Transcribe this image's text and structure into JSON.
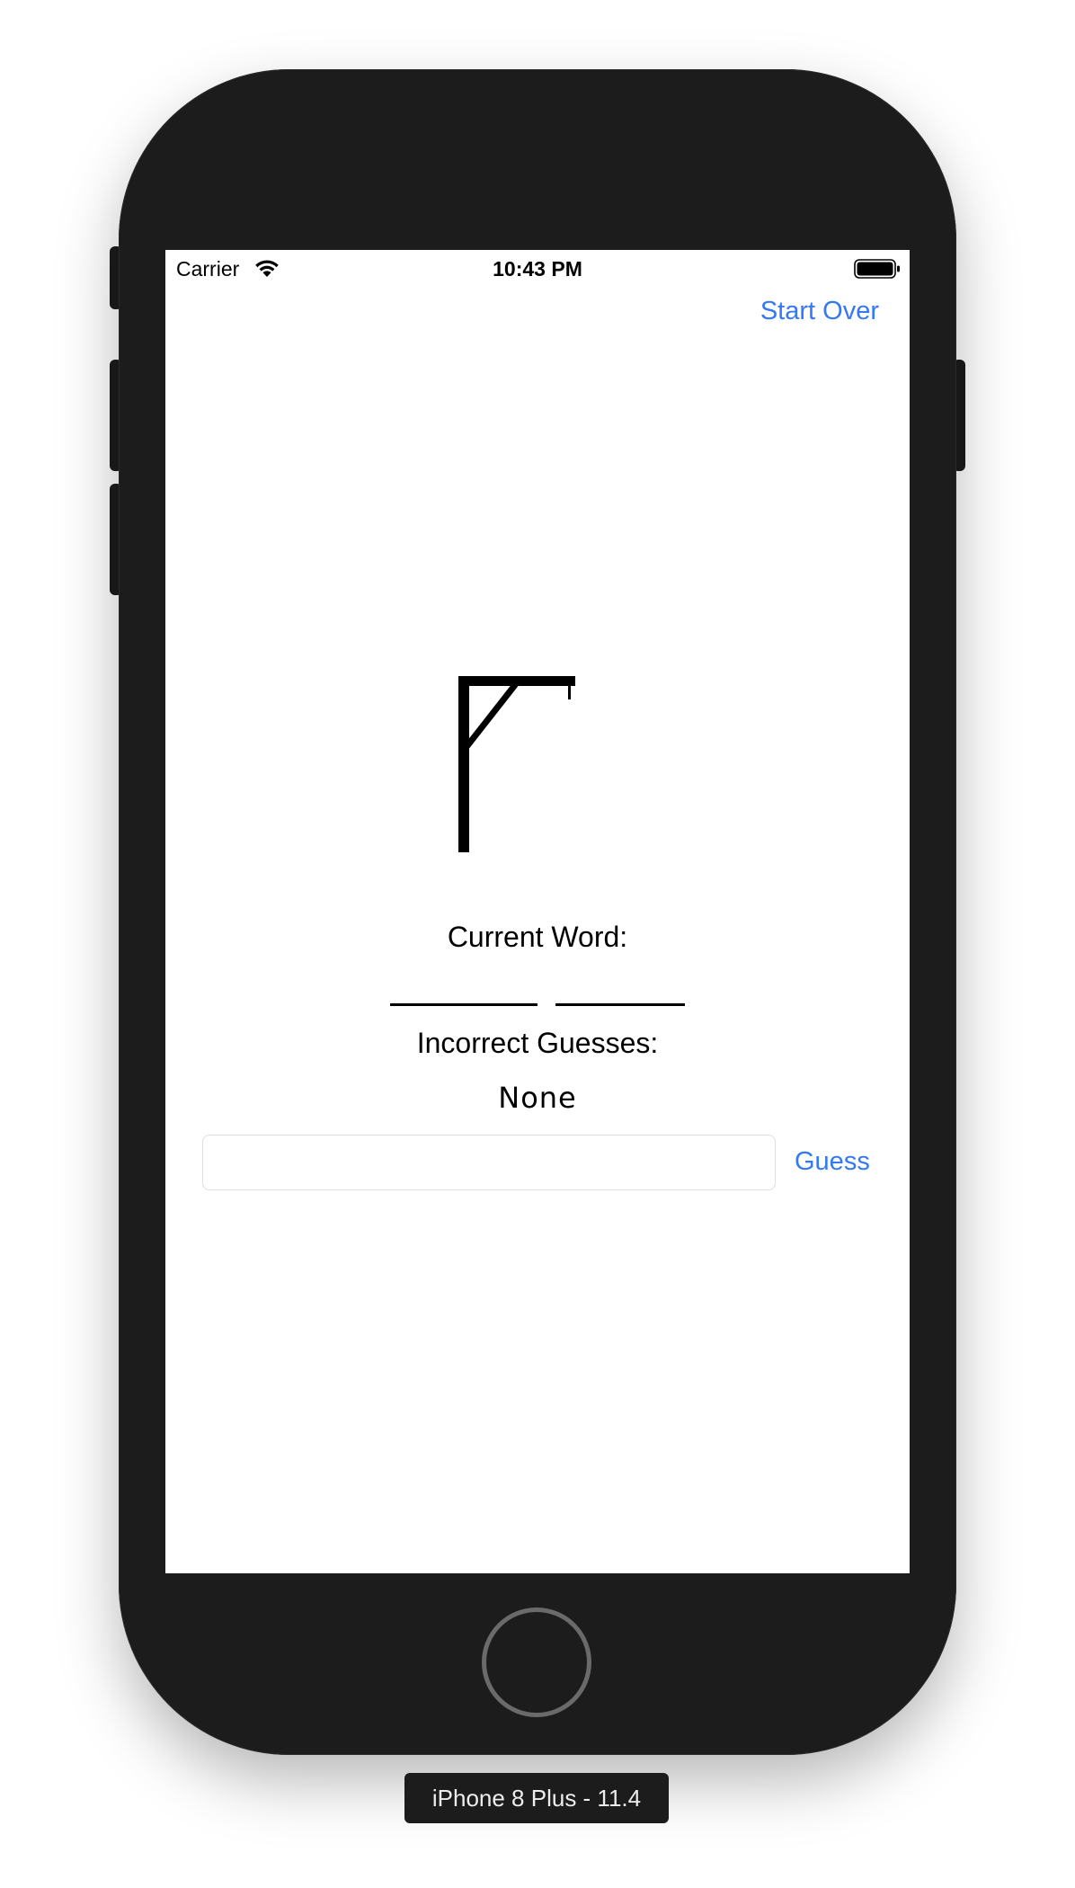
{
  "status_bar": {
    "carrier": "Carrier",
    "time": "10:43 PM"
  },
  "nav": {
    "start_over_label": "Start Over"
  },
  "game": {
    "current_word_label": "Current Word:",
    "word_display": "",
    "incorrect_label": "Incorrect Guesses:",
    "incorrect_value": "None",
    "guess_input_value": "",
    "guess_input_placeholder": "",
    "guess_button_label": "Guess"
  },
  "simulator": {
    "device_label": "iPhone 8 Plus - 11.4"
  },
  "colors": {
    "accent": "#3478f6",
    "device_body": "#1c1c1c"
  },
  "icons": {
    "wifi": "wifi-icon",
    "battery": "battery-icon",
    "gallows": "gallows-icon"
  }
}
